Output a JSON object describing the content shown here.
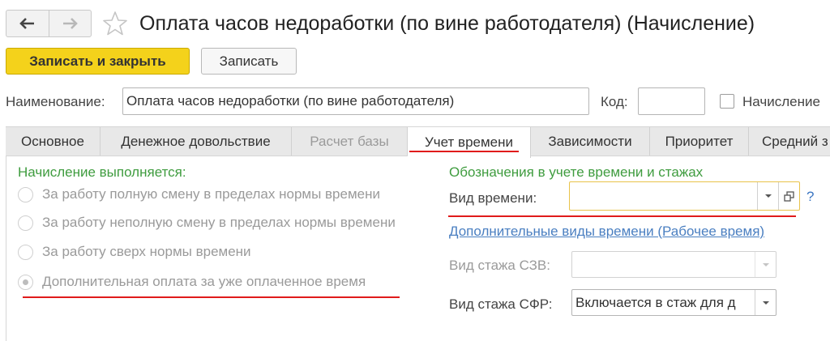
{
  "header": {
    "title": "Оплата часов недоработки (по вине работодателя) (Начисление)"
  },
  "toolbar": {
    "save_close_label": "Записать и закрыть",
    "save_label": "Записать"
  },
  "form": {
    "name_label": "Наименование:",
    "name_value": "Оплата часов недоработки (по вине работодателя)",
    "code_label": "Код:",
    "code_value": "",
    "accrual_checkbox_label": "Начисление"
  },
  "tabs": [
    {
      "label": "Основное",
      "state": "normal"
    },
    {
      "label": "Денежное довольствие",
      "state": "normal"
    },
    {
      "label": "Расчет базы",
      "state": "disabled"
    },
    {
      "label": "Учет времени",
      "state": "active"
    },
    {
      "label": "Зависимости",
      "state": "normal"
    },
    {
      "label": "Приоритет",
      "state": "normal"
    },
    {
      "label": "Средний з",
      "state": "normal"
    }
  ],
  "left_section": {
    "title": "Начисление выполняется:",
    "options": [
      {
        "label": "За работу полную смену в пределах нормы времени",
        "checked": false
      },
      {
        "label": "За работу неполную смену в пределах нормы времени",
        "checked": false
      },
      {
        "label": "За работу сверх нормы времени",
        "checked": false
      },
      {
        "label": "Дополнительная оплата за уже оплаченное время",
        "checked": true
      }
    ]
  },
  "right_section": {
    "title": "Обозначения в учете времени и стажах",
    "time_type_label": "Вид времени:",
    "time_type_value": "",
    "help_label": "?",
    "additional_link": "Дополнительные виды времени (Рабочее время)",
    "szv_label": "Вид стажа СЗВ:",
    "szv_value": "",
    "sfr_label": "Вид стажа СФР:",
    "sfr_value": "Включается в стаж для д"
  },
  "colors": {
    "primary_button": "#f4d21b",
    "section_title": "#3f9c3f",
    "link": "#4a7fc1",
    "annotation_underline": "#e01b1b"
  }
}
